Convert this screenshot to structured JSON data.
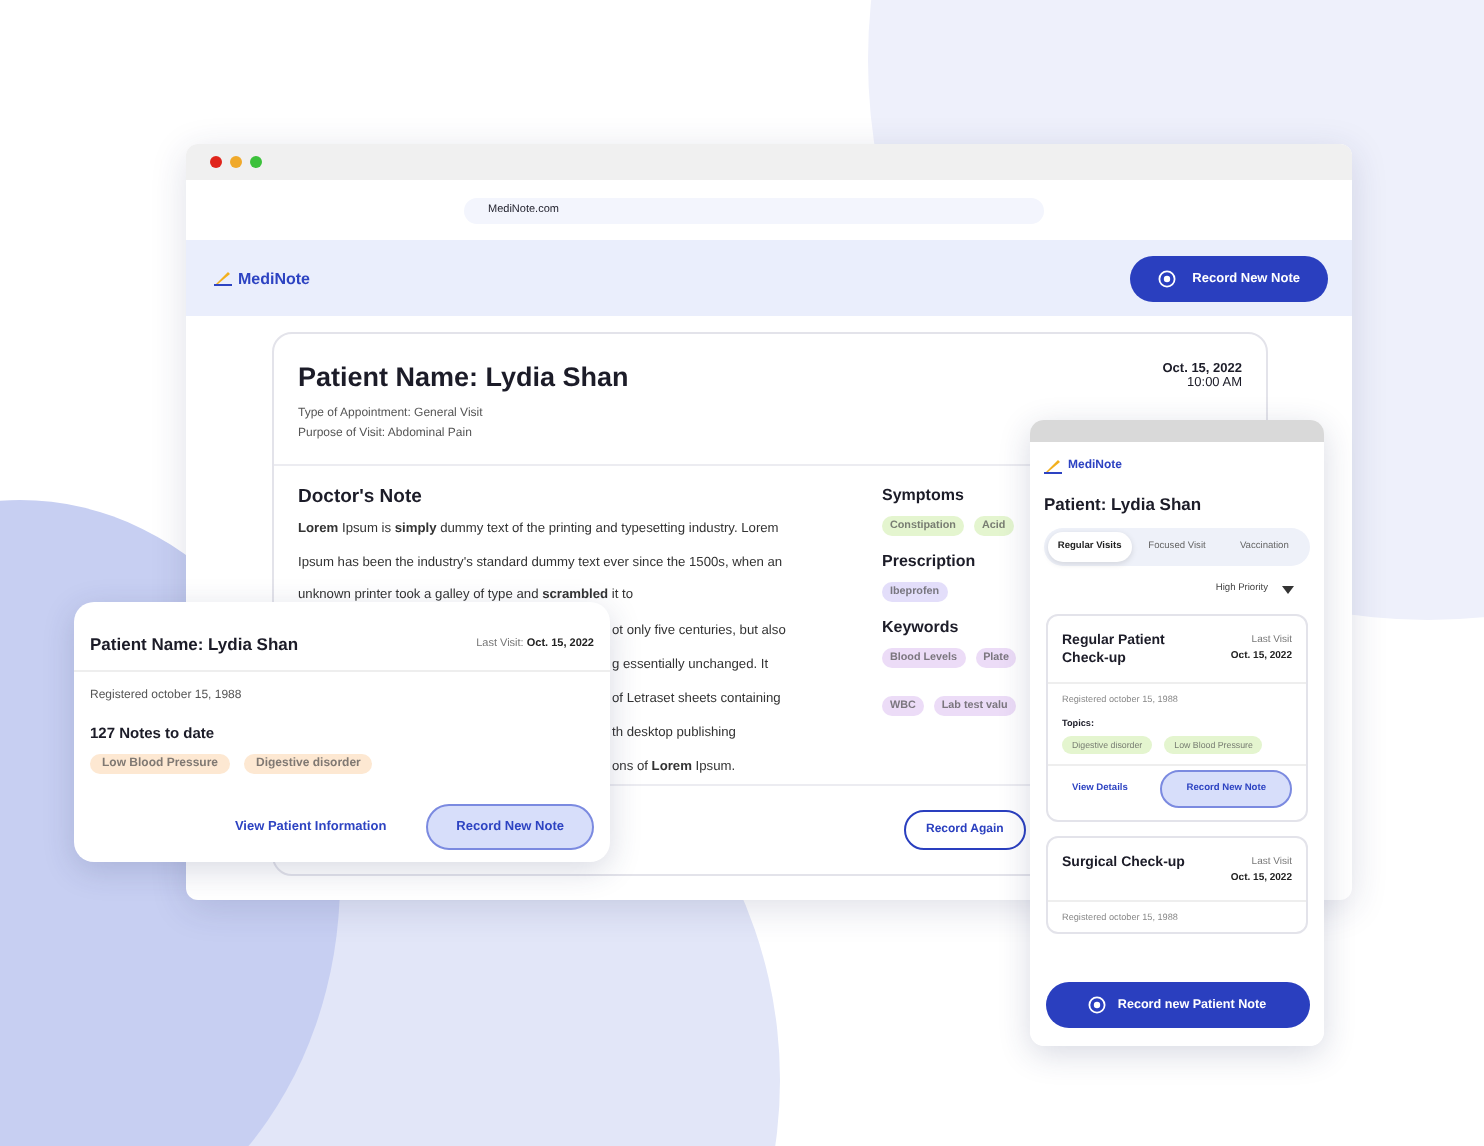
{
  "browser": {
    "url": "MediNote.com"
  },
  "app_header": {
    "logo": "MediNote",
    "button": "Record New Note"
  },
  "note_card": {
    "patient_name": "Patient Name: Lydia Shan",
    "appointment_type": "Type of Appointment: General Visit",
    "purpose": "Purpose of Visit: Abdominal Pain",
    "date": "Oct. 15, 2022",
    "time": "10:00 AM",
    "note_title": "Doctor's Note",
    "note_text": "**Lorem** Ipsum is **simply** dummy text of the printing and typesetting industry. Lorem Ipsum has been the industry's standard dummy text ever since the 1500s, when an unknown printer took a galley of type and **scrambled** it to",
    "note_fragments": [
      "ot only five centuries, but also",
      "g essentially unchanged. It",
      "of Letraset sheets containing",
      "th desktop publishing",
      "ons of **Lorem** Ipsum."
    ],
    "sections": [
      {
        "title": "Symptoms",
        "tags": [
          {
            "label": "Constipation",
            "color": "#e4f5cf"
          },
          {
            "label": "Acid",
            "color": "#e4f5cf"
          }
        ]
      },
      {
        "title": "Prescription",
        "tags": [
          {
            "label": "Ibeprofen",
            "color": "#e3defa"
          }
        ]
      },
      {
        "title": "Keywords",
        "tags": [
          {
            "label": "Blood Levels",
            "color": "#ecdcf7"
          },
          {
            "label": "Plate",
            "color": "#ecdcf7"
          },
          {
            "label": "WBC",
            "color": "#ecdcf7"
          },
          {
            "label": "Lab test valu",
            "color": "#ecdcf7"
          }
        ]
      }
    ],
    "button": "Record Again"
  },
  "patient_card": {
    "name": "Patient Name: Lydia Shan",
    "last_visit": "Last Visit: **Oct. 15, 2022**",
    "registered": "Registered october 15, 1988",
    "notes_count": "127 Notes to date",
    "tags": [
      {
        "label": "Low Blood Pressure",
        "color": "#fde8d2"
      },
      {
        "label": "Digestive disorder",
        "color": "#fde8d2"
      }
    ],
    "link": "View Patient Information",
    "button": "Record New Note"
  },
  "phone": {
    "logo": "MediNote",
    "title": "Patient: Lydia Shan",
    "tabs": [
      {
        "label": "Regular Visits",
        "selected": true
      },
      {
        "label": "Focused Visit",
        "selected": false
      },
      {
        "label": "Vaccination",
        "selected": false
      }
    ],
    "filter": "High Priority",
    "visits": [
      {
        "title": "Regular Patient Check-up",
        "last_visit_label": "Last Visit",
        "date": "Oct. 15, 2022",
        "registered": "Registered october 15, 1988",
        "topics_label": "Topics:",
        "topics": [
          {
            "label": "Digestive disorder",
            "color": "#e4f5cf"
          },
          {
            "label": "Low Blood Pressure",
            "color": "#e4f5cf"
          }
        ],
        "link": "View Details",
        "button": "Record New Note"
      },
      {
        "title": "Surgical Check-up",
        "last_visit_label": "Last Visit",
        "date": "Oct. 15, 2022",
        "registered": "Registered october 15, 1988"
      }
    ],
    "button": "Record new Patient Note"
  }
}
